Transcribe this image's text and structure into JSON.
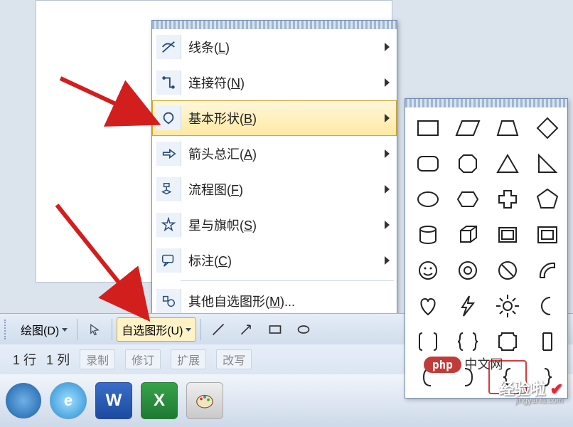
{
  "toolbar": {
    "draw_label": "绘图(D)",
    "autoshapes_label": "自选图形(U)"
  },
  "status": {
    "row_value": "1",
    "row_label": "行",
    "col_value": "1",
    "col_label": "列",
    "cells": [
      "录制",
      "修订",
      "扩展",
      "改写"
    ]
  },
  "menu": {
    "items": [
      {
        "label": "线条",
        "mnemonic": "L"
      },
      {
        "label": "连接符",
        "mnemonic": "N"
      },
      {
        "label": "基本形状",
        "mnemonic": "B",
        "highlight": true
      },
      {
        "label": "箭头总汇",
        "mnemonic": "A"
      },
      {
        "label": "流程图",
        "mnemonic": "F"
      },
      {
        "label": "星与旗帜",
        "mnemonic": "S"
      },
      {
        "label": "标注",
        "mnemonic": "C"
      }
    ],
    "more_label": "其他自选图形",
    "more_mnemonic": "M"
  },
  "palette": {
    "shapes": [
      "rectangle",
      "parallelogram",
      "trapezoid",
      "diamond",
      "round-rect",
      "octagon",
      "triangle",
      "right-triangle",
      "ellipse",
      "hexagon",
      "plus",
      "pentagon",
      "cylinder",
      "cube",
      "bevel",
      "frame",
      "smiley",
      "donut",
      "no-symbol",
      "arc-quarter",
      "heart",
      "lightning",
      "sun",
      "moon",
      "double-bracket",
      "double-brace",
      "plaque",
      "bracket",
      "left-bracket",
      "right-bracket",
      "left-brace",
      "right-brace"
    ],
    "selected_index": 30
  },
  "watermark": {
    "line1": "经验啦",
    "line2": "jingyanla.com",
    "php": "php",
    "cn": "中文网"
  }
}
